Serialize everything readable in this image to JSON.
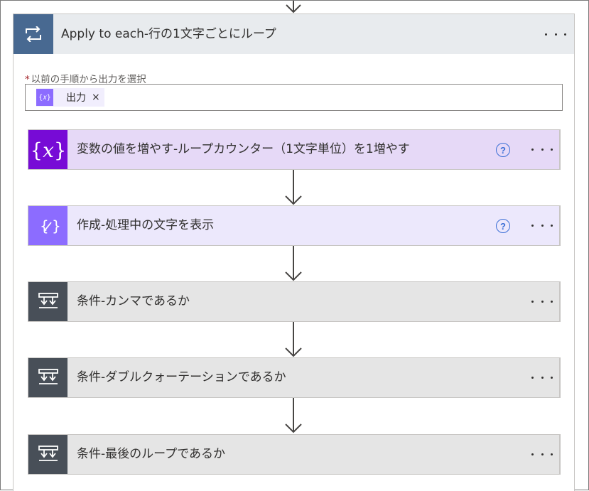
{
  "loop": {
    "title": "Apply to each-行の1文字ごとにループ",
    "icon": "loop-icon",
    "field_label": "以前の手順から出力を選択",
    "required_marker": "*",
    "token": {
      "icon": "variable-token-icon",
      "icon_text": "{𝑥}",
      "label": "出力",
      "close": "×"
    }
  },
  "actions": [
    {
      "title": "変数の値を増やす-ループカウンター（1文字単位）を1増やす",
      "icon": "variable-icon",
      "color": "#770bd6",
      "bg": "#e6d9f7",
      "help": "?"
    },
    {
      "title": "作成-処理中の文字を表示",
      "icon": "compose-icon",
      "color": "#8c6cff",
      "bg": "#ece8fc",
      "help": "?"
    },
    {
      "title": "条件-カンマであるか",
      "icon": "condition-icon",
      "color": "#484f58",
      "bg": "#e5e5e5"
    },
    {
      "title": "条件-ダブルクォーテーションであるか",
      "icon": "condition-icon",
      "color": "#484f58",
      "bg": "#e5e5e5"
    },
    {
      "title": "条件-最後のループであるか",
      "icon": "condition-icon",
      "color": "#484f58",
      "bg": "#e5e5e5"
    }
  ],
  "colors": {
    "loop_header_bg": "#e8ebee",
    "loop_icon_bg": "#486991",
    "help_blue": "#3b6fd6",
    "required_red": "#a4262c"
  }
}
